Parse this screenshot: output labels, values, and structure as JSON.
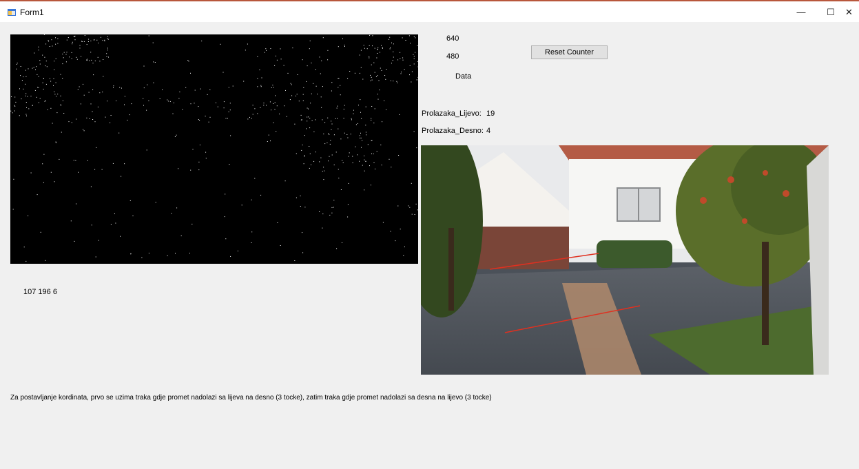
{
  "window": {
    "title": "Form1",
    "min": "—",
    "max": "☐",
    "close": "✕"
  },
  "readouts": {
    "width": "640",
    "height": "480",
    "data_label": "Data"
  },
  "reset_button": "Reset Counter",
  "counters": {
    "left_label": "Prolazaka_Lijevo:",
    "left_value": "19",
    "right_label": "Prolazaka_Desno:",
    "right_value": "4"
  },
  "rgb_readout": "107 196 6",
  "instruction": "Za postavljanje kordinata, prvo se uzima traka gdje promet nadolazi sa lijeva na desno (3 tocke), zatim traka gdje promet nadolazi sa desna na lijevo (3 tocke)"
}
